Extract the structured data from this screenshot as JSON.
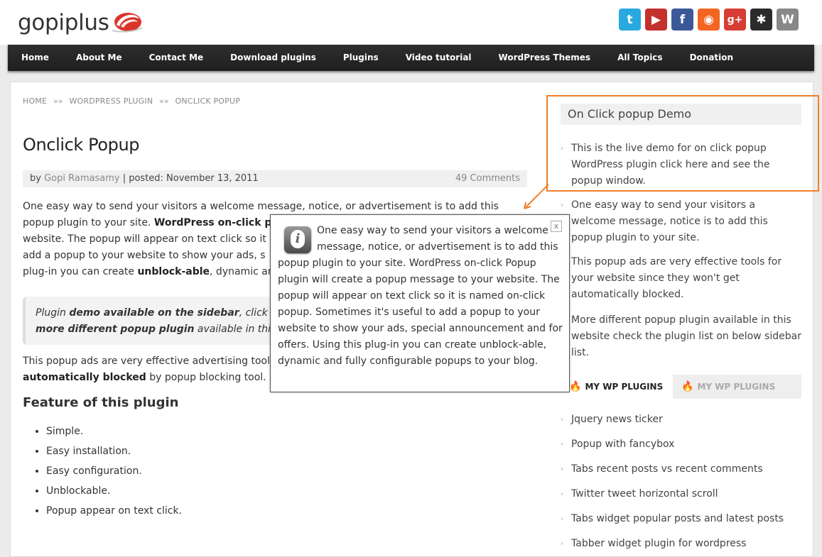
{
  "brand": {
    "name": "gopiplus"
  },
  "social": [
    {
      "icon": "twitter-icon",
      "color": "#2aa9e0",
      "glyph": "t"
    },
    {
      "icon": "youtube-icon",
      "color": "#c4302b",
      "glyph": "▶"
    },
    {
      "icon": "facebook-icon",
      "color": "#3b5998",
      "glyph": "f"
    },
    {
      "icon": "rss-icon",
      "color": "#f26522",
      "glyph": "◉"
    },
    {
      "icon": "google-plus-icon",
      "color": "#d73d32",
      "glyph": "g+"
    },
    {
      "icon": "joomla-icon",
      "color": "#2b2b2b",
      "glyph": "✱"
    },
    {
      "icon": "wordpress-icon",
      "color": "#888888",
      "glyph": "W"
    }
  ],
  "nav": [
    "Home",
    "About Me",
    "Contact Me",
    "Download plugins",
    "Plugins",
    "Video tutorial",
    "WordPress Themes",
    "All Topics",
    "Donation"
  ],
  "breadcrumb": {
    "home": "HOME",
    "sep": "»»",
    "section": "WORDPRESS PLUGIN",
    "current": "ONCLICK POPUP"
  },
  "post": {
    "title": "Onclick Popup",
    "by_label": "by",
    "author": "Gopi Ramasamy",
    "posted": "| posted: November 13, 2011",
    "comments": "49 Comments",
    "p1_a": "One easy way to send your visitors a welcome message, notice, or advertisement is to add this",
    "p1_b": "popup plugin to your site. ",
    "p1_b_bold": "WordPress on-click p",
    "p1_c": "website. The popup will appear on text click so it",
    "p1_d": "add a popup to your website to show your ads, s",
    "p1_e": "plug-in you can create ",
    "p1_e_bold": "unblock-able",
    "p1_e2": ", dynamic an",
    "quote_a": "Plugin ",
    "quote_a_bold": "demo available on the sidebar",
    "quote_a2": ", click o",
    "quote_b_bold": "more different popup plugin",
    "quote_b2": " available in this",
    "p2_a": "This popup ads are very effective advertising tool",
    "p2_b_bold": "automatically blocked",
    "p2_b2": " by popup blocking tool.",
    "feature_heading": "Feature of this plugin",
    "features": [
      "Simple.",
      "Easy installation.",
      "Easy configuration.",
      "Unblockable.",
      "Popup appear on text click."
    ]
  },
  "popup": {
    "close": "x",
    "text": "One easy way to send your visitors a welcome message, notice, or advertisement is to add this popup plugin to your site. WordPress on-click Popup plugin will create a popup message to your website. The popup will appear on text click so it is named on-click popup. Sometimes it's useful to add a popup to your website to show your ads, special announcement and for offers. Using this plug-in you can create unblock-able, dynamic and fully configurable popups to your blog."
  },
  "sidebar": {
    "title": "On Click popup Demo",
    "items": [
      "This is the live demo for on click popup WordPress plugin click here and see the popup window.",
      "One easy way to send your visitors a welcome message, notice is to add this popup plugin to your site.",
      "This popup ads are very effective tools for your website since they won't get automatically blocked.",
      "More different popup plugin available in this website check the plugin list on below sidebar list."
    ],
    "tabs": [
      "MY WP PLUGINS",
      "MY WP PLUGINS"
    ],
    "plugins": [
      "Jquery news ticker",
      "Popup with fancybox",
      "Tabs recent posts vs recent comments",
      "Twitter tweet horizontal scroll",
      "Tabs widget popular posts and latest posts",
      "Tabber widget plugin for wordpress"
    ]
  },
  "colors": {
    "accent": "#f07f2a",
    "nav_bg": "#262626"
  }
}
